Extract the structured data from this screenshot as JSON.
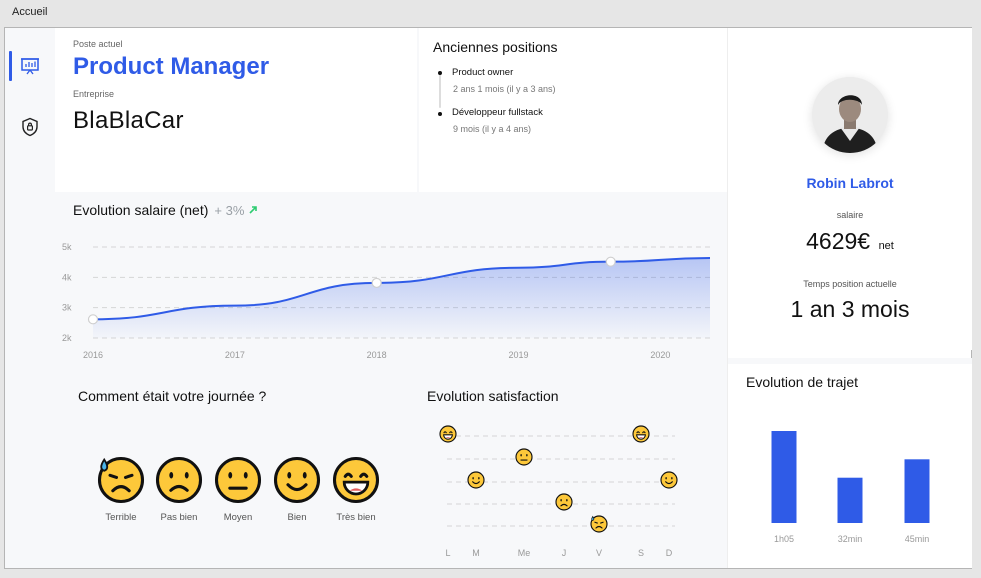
{
  "window": {
    "title": "Accueil"
  },
  "nav": {
    "items": [
      {
        "icon": "presentation-chart-icon",
        "active": true
      },
      {
        "icon": "shield-lock-icon",
        "active": false
      }
    ]
  },
  "job": {
    "current_label": "Poste actuel",
    "current_title": "Product Manager",
    "company_label": "Entreprise",
    "company": "BlaBlaCar"
  },
  "history": {
    "title": "Anciennes positions",
    "items": [
      {
        "title": "Product owner",
        "duration": "2 ans 1 mois (il y a 3 ans)"
      },
      {
        "title": "Développeur fullstack",
        "duration": "9 mois (il y a 4 ans)"
      }
    ]
  },
  "salary_chart": {
    "title": "Evolution salaire (net)",
    "growth": "+ 3%",
    "accent": "#2f5be7",
    "growth_color": "#2ecc71"
  },
  "chart_data": [
    {
      "type": "area",
      "title": "Evolution salaire (net)",
      "x_ticks": [
        "2016",
        "2017",
        "2018",
        "2019",
        "2020"
      ],
      "y_ticks": [
        "2k",
        "3k",
        "4k",
        "5k"
      ],
      "ylim": [
        2000,
        5000
      ],
      "xlim": [
        2016,
        2020.35
      ],
      "x": [
        2016,
        2017,
        2018,
        2019,
        2019.65,
        2020.35
      ],
      "y": [
        2550,
        3000,
        3750,
        4250,
        4450,
        4570
      ],
      "markers_x": [
        2016,
        2018,
        2019.65
      ],
      "markers_y": [
        2550,
        3750,
        4450
      ],
      "grid": true
    },
    {
      "type": "scatter",
      "title": "Evolution satisfaction",
      "x_ticks": [
        "L",
        "M",
        "Me",
        "J",
        "V",
        "S",
        "D"
      ],
      "points": [
        {
          "day": "L",
          "mood": "Très bien"
        },
        {
          "day": "M",
          "mood": "Bien"
        },
        {
          "day": "Me",
          "mood": "Moyen"
        },
        {
          "day": "J",
          "mood": "Pas bien"
        },
        {
          "day": "V",
          "mood": "Terrible"
        },
        {
          "day": "S",
          "mood": "Très bien"
        },
        {
          "day": "D",
          "mood": "Bien"
        }
      ],
      "grid": true
    },
    {
      "type": "bar",
      "title": "Evolution de trajet",
      "categories": [
        "1h05",
        "32min",
        "45min"
      ],
      "values": [
        65,
        32,
        45
      ],
      "ylim": [
        0,
        65
      ],
      "color": "#2f5be7"
    }
  ],
  "mood": {
    "title": "Comment était votre journée ?",
    "options": [
      {
        "key": "terrible",
        "label": "Terrible",
        "icon": "sweat-frown-emoji-icon"
      },
      {
        "key": "pas-bien",
        "label": "Pas bien",
        "icon": "frown-emoji-icon"
      },
      {
        "key": "moyen",
        "label": "Moyen",
        "icon": "neutral-emoji-icon"
      },
      {
        "key": "bien",
        "label": "Bien",
        "icon": "smile-emoji-icon"
      },
      {
        "key": "tres-bien",
        "label": "Très bien",
        "icon": "grin-emoji-icon"
      }
    ],
    "emoji_color": "#fdc83a"
  },
  "satisfaction": {
    "title": "Evolution satisfaction"
  },
  "profile": {
    "name": "Robin Labrot",
    "salary_label": "salaire",
    "salary_value": "4629€",
    "salary_suffix": "net",
    "tenure_label": "Temps position actuelle",
    "tenure_value": "1 an 3 mois"
  },
  "commute": {
    "title": "Evolution de trajet"
  }
}
